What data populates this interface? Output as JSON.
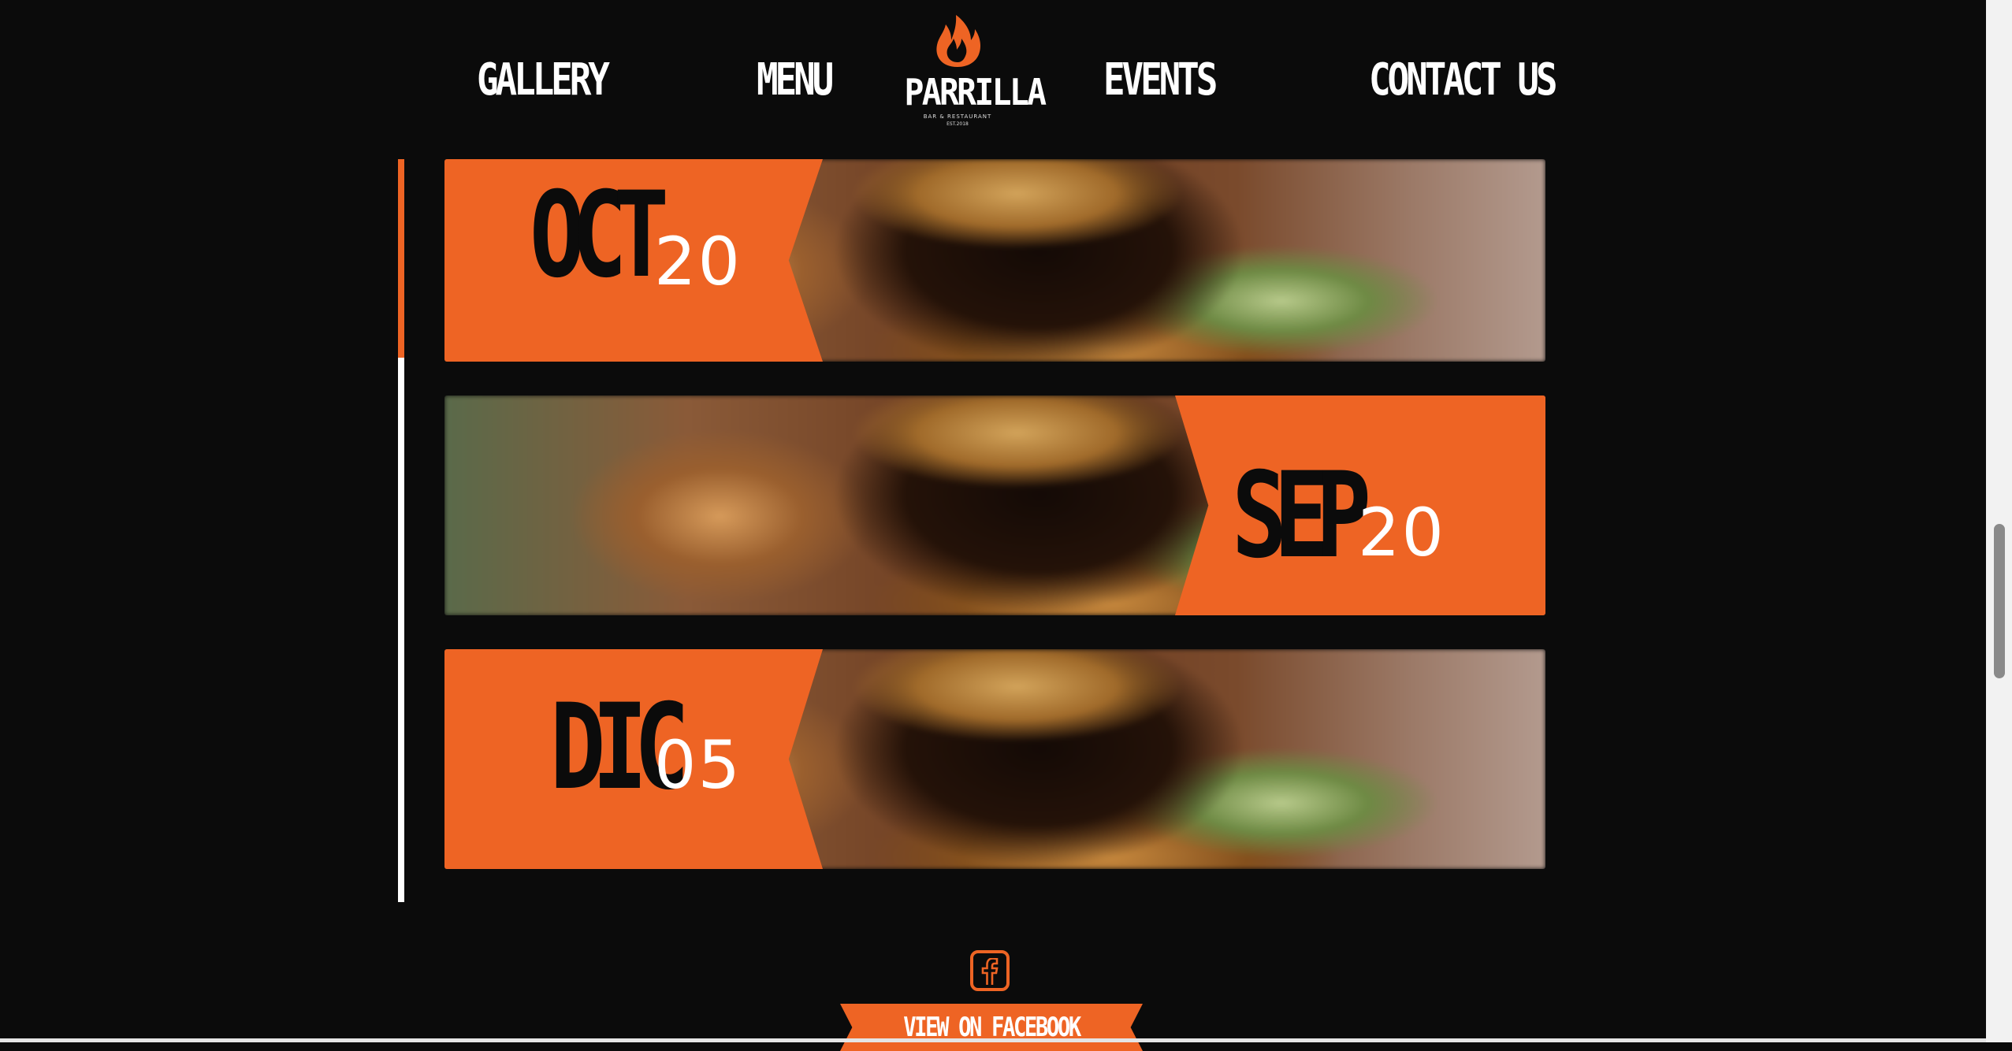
{
  "nav": {
    "gallery": "GALLERY",
    "menu": "MENU",
    "events": "EVENTS",
    "contact": "CONTACT US"
  },
  "logo": {
    "name": "PARRILLA",
    "tagline": "BAR & RESTAURANT",
    "est": "EST.2018",
    "icon": "flame-icon"
  },
  "events": [
    {
      "month": "OCT",
      "day": "20",
      "layout": "date-left"
    },
    {
      "month": "SEP",
      "day": "20",
      "layout": "date-right"
    },
    {
      "month": "DIC",
      "day": "05",
      "layout": "date-left"
    }
  ],
  "social": {
    "icon": "facebook-icon",
    "button_label": "VIEW ON FACEBOOK"
  },
  "colors": {
    "background": "#0b0b0b",
    "accent": "#ee6424",
    "text": "#ffffff"
  }
}
